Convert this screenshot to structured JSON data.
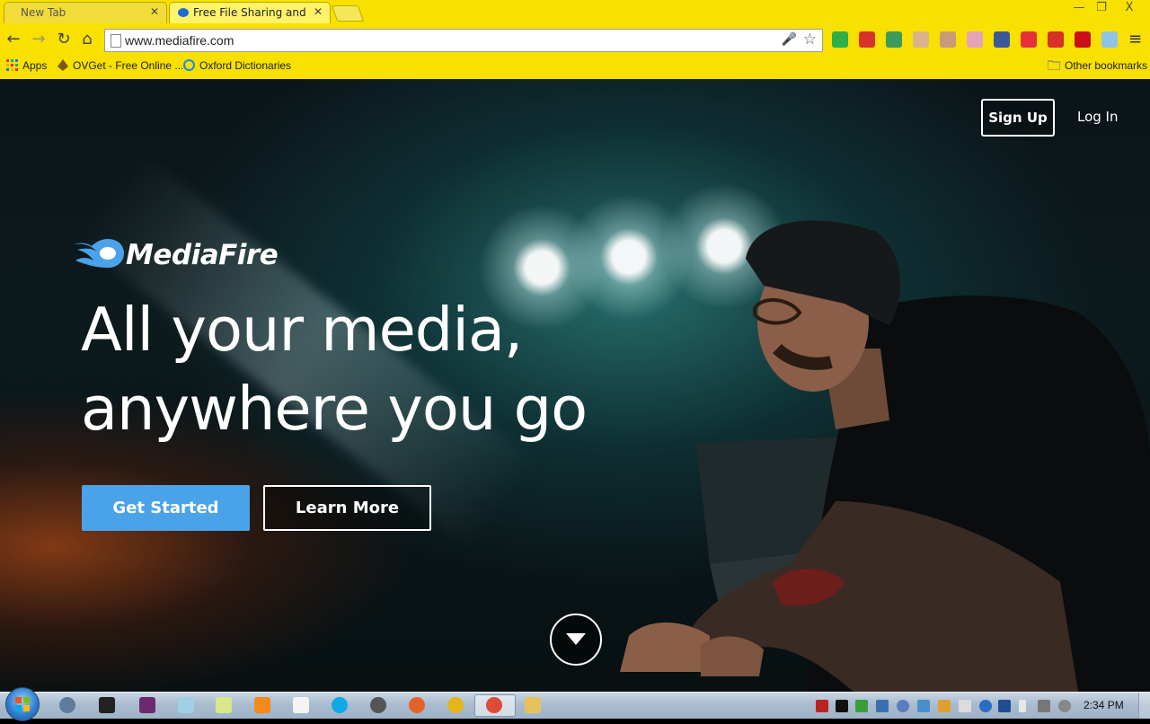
{
  "browser": {
    "tabs": [
      {
        "title": "New Tab",
        "active": false
      },
      {
        "title": "Free File Sharing and Stor",
        "active": true
      }
    ],
    "close_glyph": "✕",
    "window_controls": {
      "minimize": "—",
      "restore": "❐",
      "close": "X"
    },
    "nav": {
      "back": "←",
      "forward": "→",
      "reload": "↻",
      "home": "⌂"
    },
    "address": {
      "url": "www.mediafire.com"
    },
    "mic_glyph": "🎤",
    "star_glyph": "☆",
    "menu_glyph": "≡",
    "extensions": [
      {
        "name": "ext-green-icon",
        "color": "#2fae4a"
      },
      {
        "name": "ext-red-book-icon",
        "color": "#d7332b"
      },
      {
        "name": "ext-map-icon",
        "color": "#3c9a5a"
      },
      {
        "name": "ext-face-1-icon",
        "color": "#d8b48a"
      },
      {
        "name": "ext-face-2-icon",
        "color": "#c99a7a"
      },
      {
        "name": "ext-character-icon",
        "color": "#e6a2b8"
      },
      {
        "name": "facebook-icon",
        "color": "#3b5998"
      },
      {
        "name": "ebay-icon",
        "color": "#e53238"
      },
      {
        "name": "gmail-icon",
        "color": "#d93025"
      },
      {
        "name": "opera-badge-icon",
        "color": "#cc0f16"
      },
      {
        "name": "weather-icon",
        "color": "#8fc3e8"
      }
    ],
    "bookmarks": [
      {
        "label": "Apps"
      },
      {
        "label": "OVGet - Free Online ..."
      },
      {
        "label": "Oxford Dictionaries"
      }
    ],
    "other_bookmarks": "Other bookmarks"
  },
  "page": {
    "nav": {
      "signup": "Sign Up",
      "login": "Log In"
    },
    "brand": "MediaFire",
    "headline": {
      "line1": "All your media,",
      "line2": "anywhere you go"
    },
    "cta": {
      "primary": "Get Started",
      "secondary": "Learn More"
    },
    "colors": {
      "accent": "#4aa3e8",
      "chrome": "#f8e000"
    }
  },
  "taskbar": {
    "clock": "2:34 PM"
  }
}
